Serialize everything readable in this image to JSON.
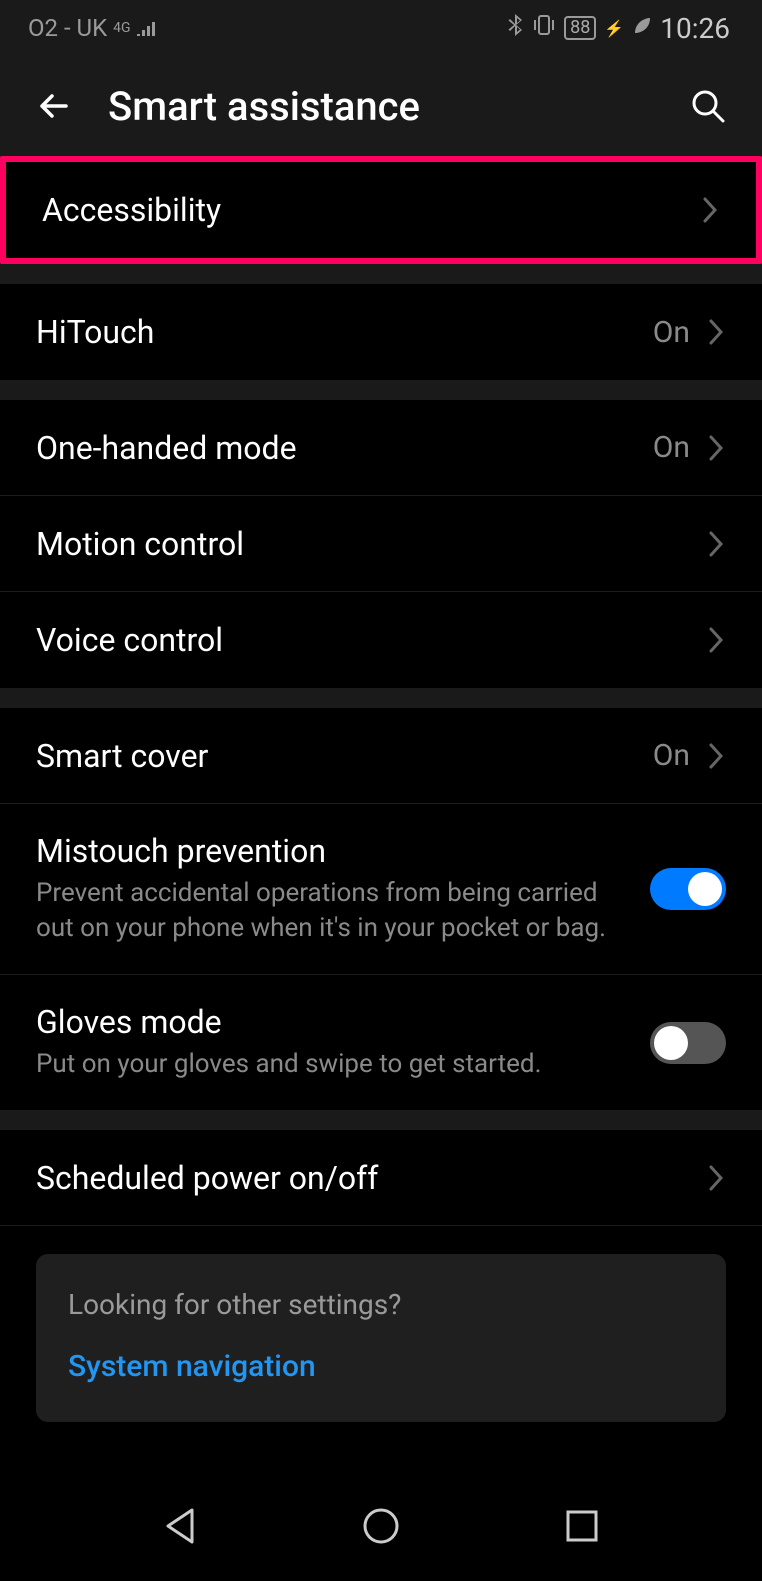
{
  "status": {
    "carrier": "O2 - UK",
    "network": "4G",
    "battery": "88",
    "time": "10:26"
  },
  "header": {
    "title": "Smart assistance"
  },
  "rows": {
    "accessibility": {
      "label": "Accessibility"
    },
    "hitouch": {
      "label": "HiTouch",
      "value": "On"
    },
    "one_handed": {
      "label": "One-handed mode",
      "value": "On"
    },
    "motion": {
      "label": "Motion control"
    },
    "voice": {
      "label": "Voice control"
    },
    "smart_cover": {
      "label": "Smart cover",
      "value": "On"
    },
    "mistouch": {
      "label": "Mistouch prevention",
      "desc": "Prevent accidental operations from being carried out on your phone when it's in your pocket or bag."
    },
    "gloves": {
      "label": "Gloves mode",
      "desc": "Put on your gloves and swipe to get started."
    },
    "scheduled": {
      "label": "Scheduled power on/off"
    }
  },
  "other": {
    "title": "Looking for other settings?",
    "link": "System navigation"
  }
}
